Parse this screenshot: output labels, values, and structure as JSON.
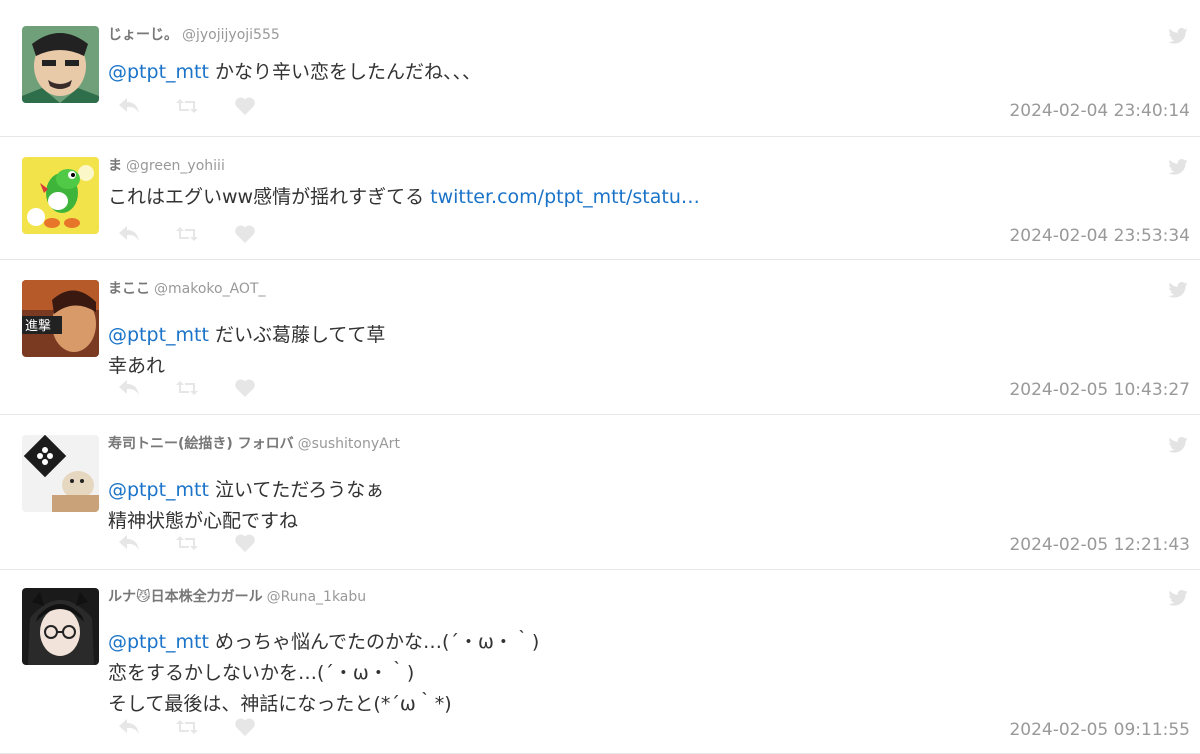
{
  "colors": {
    "link": "#1a73c8",
    "meta": "#999999",
    "name": "#777777",
    "divider": "#e6e6e6"
  },
  "icons": {
    "reply": "reply-icon",
    "retweet": "retweet-icon",
    "like": "heart-icon",
    "source": "twitter-bird-icon"
  },
  "tweets": [
    {
      "name": "じょーじ。",
      "handle": "@jyojijyoji555",
      "mention": "@ptpt_mtt",
      "body": " かなり辛い恋をしたんだね、、、",
      "link": "",
      "time": "2024-02-04 23:40:14"
    },
    {
      "name": "ま",
      "handle": "@green_yohiii",
      "mention": "",
      "body": "これはエグいww感情が揺れすぎてる ",
      "link": "twitter.com/ptpt_mtt/statu…",
      "time": "2024-02-04 23:53:34"
    },
    {
      "name": "まここ",
      "handle": "@makoko_AOT_",
      "mention": "@ptpt_mtt",
      "body": " だいぶ葛藤してて草\n幸あれ",
      "link": "",
      "time": "2024-02-05 10:43:27"
    },
    {
      "name": "寿司トニー(絵描き) フォロバ",
      "handle": "@sushitonyArt",
      "mention": "@ptpt_mtt",
      "body": " 泣いてただろうなぁ\n精神状態が心配ですね",
      "link": "",
      "time": "2024-02-05 12:21:43"
    },
    {
      "name": "ルナ😼日本株全力ガール",
      "handle": "@Runa_1kabu",
      "mention": "@ptpt_mtt",
      "body": " めっちゃ悩んでたのかな…(´・ω・｀)\n恋をするかしないかを…(´・ω・｀)\nそして最後は、神話になったと(*´ω｀*)",
      "link": "",
      "time": "2024-02-05 09:11:55"
    }
  ]
}
